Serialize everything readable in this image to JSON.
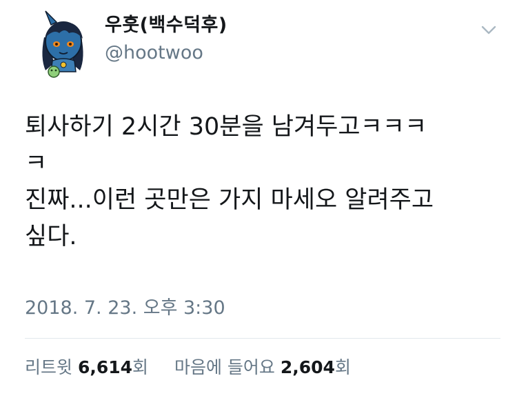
{
  "user": {
    "display_name": "우훗(백수덕후)",
    "handle": "@hootwoo",
    "avatar_icon": "avatar-blue-demon-character-icon"
  },
  "menu": {
    "caret_icon": "chevron-down-icon"
  },
  "tweet": {
    "text_lines": [
      "퇴사하기 2시간 30분을 남겨두고ㅋㅋㅋ",
      "ㅋ",
      "진짜...이런 곳만은 가지 마세오 알려주고",
      "싶다."
    ],
    "timestamp": "2018. 7. 23. 오후 3:30"
  },
  "stats": {
    "retweets_label": "리트윗",
    "retweets_count": "6,614",
    "retweets_unit": "회",
    "likes_label": "마음에 들어요",
    "likes_count": "2,604",
    "likes_unit": "회"
  },
  "colors": {
    "primary_text": "#14171a",
    "secondary_text": "#657786",
    "divider": "#e1e8ed",
    "avatar_skin": "#2d6fa8",
    "avatar_hair": "#1a2740"
  }
}
